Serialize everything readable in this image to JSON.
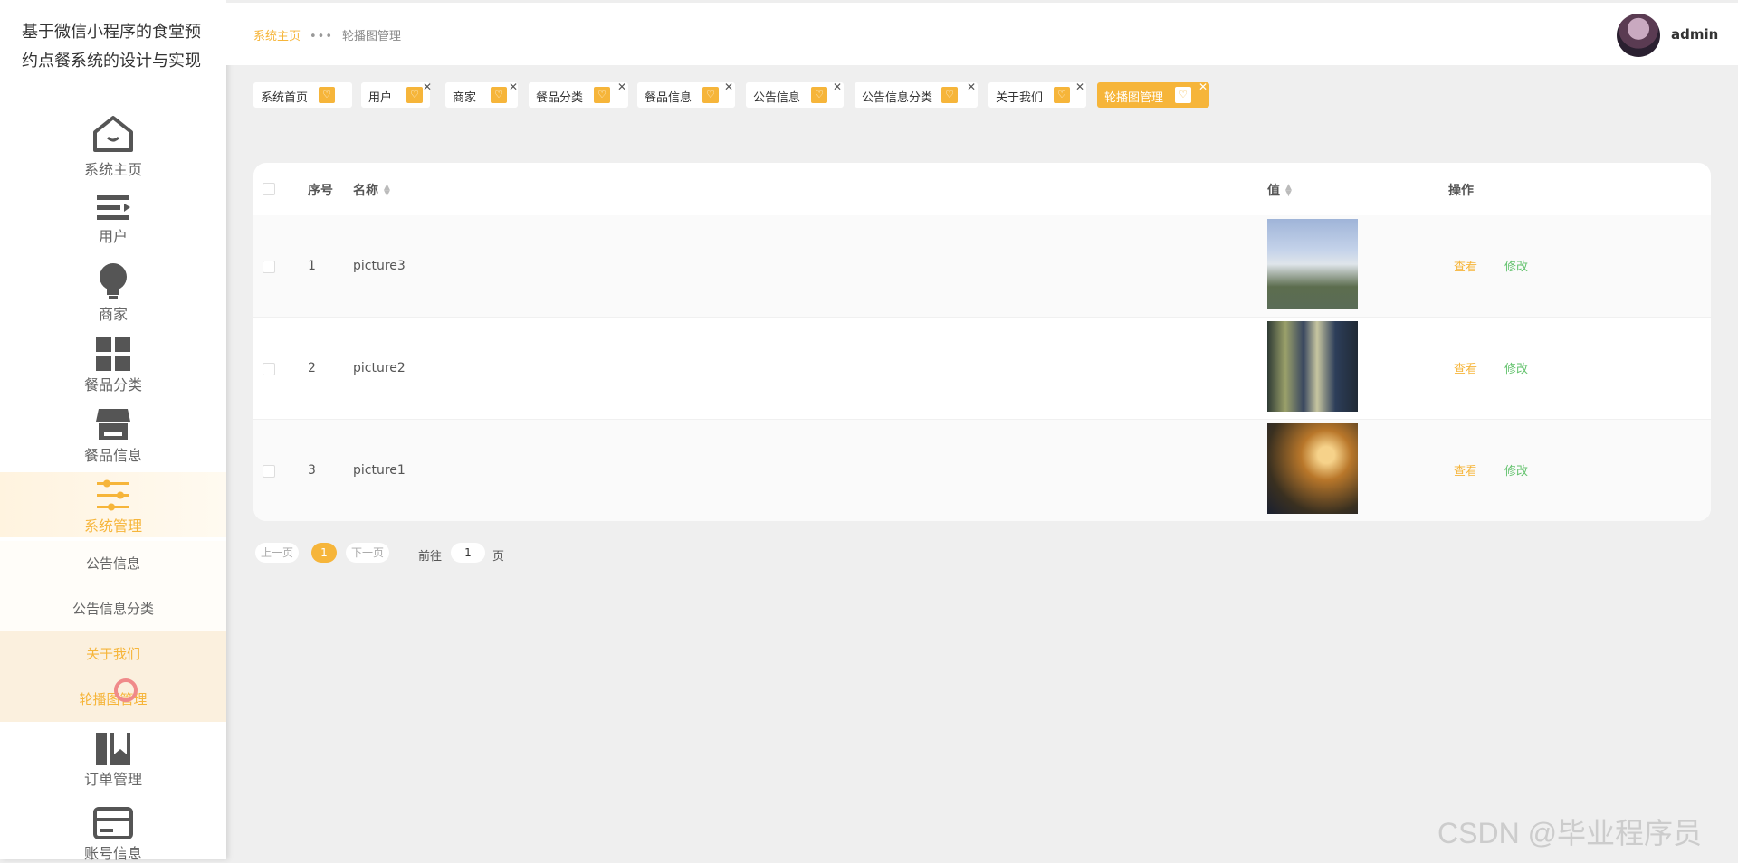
{
  "app": {
    "title": "基于微信小程序的食堂预约点餐系统的设计与实现"
  },
  "sidebar": {
    "items": [
      {
        "label": "系统主页",
        "icon": "home-icon"
      },
      {
        "label": "用户",
        "icon": "list-icon"
      },
      {
        "label": "商家",
        "icon": "bulb-icon"
      },
      {
        "label": "餐品分类",
        "icon": "grid-icon"
      },
      {
        "label": "餐品信息",
        "icon": "shop-icon"
      },
      {
        "label": "系统管理",
        "icon": "sliders-icon",
        "active": true
      },
      {
        "label": "订单管理",
        "icon": "bookmark-icon"
      },
      {
        "label": "账号信息",
        "icon": "card-icon"
      }
    ],
    "submenu": [
      "公告信息",
      "公告信息分类",
      "关于我们",
      "轮播图管理"
    ]
  },
  "header": {
    "breadcrumb": {
      "home": "系统主页",
      "current": "轮播图管理"
    },
    "user": "admin"
  },
  "tabs": [
    {
      "label": "系统首页",
      "closable": false
    },
    {
      "label": "用户",
      "closable": true
    },
    {
      "label": "商家",
      "closable": true
    },
    {
      "label": "餐品分类",
      "closable": true
    },
    {
      "label": "餐品信息",
      "closable": true
    },
    {
      "label": "公告信息",
      "closable": true
    },
    {
      "label": "公告信息分类",
      "closable": true
    },
    {
      "label": "关于我们",
      "closable": true
    },
    {
      "label": "轮播图管理",
      "closable": true,
      "active": true
    }
  ],
  "table": {
    "columns": {
      "index": "序号",
      "name": "名称",
      "value": "值",
      "actions": "操作"
    },
    "rows": [
      {
        "index": "1",
        "name": "picture3",
        "view": "查看",
        "edit": "修改"
      },
      {
        "index": "2",
        "name": "picture2",
        "view": "查看",
        "edit": "修改"
      },
      {
        "index": "3",
        "name": "picture1",
        "view": "查看",
        "edit": "修改"
      }
    ]
  },
  "pagination": {
    "prev": "上一页",
    "current": "1",
    "next": "下一页",
    "goto_label": "前往",
    "goto_value": "1",
    "page_suffix": "页"
  },
  "watermark": "CSDN @毕业程序员",
  "colors": {
    "accent": "#f6b53a",
    "edit": "#62c26c"
  }
}
